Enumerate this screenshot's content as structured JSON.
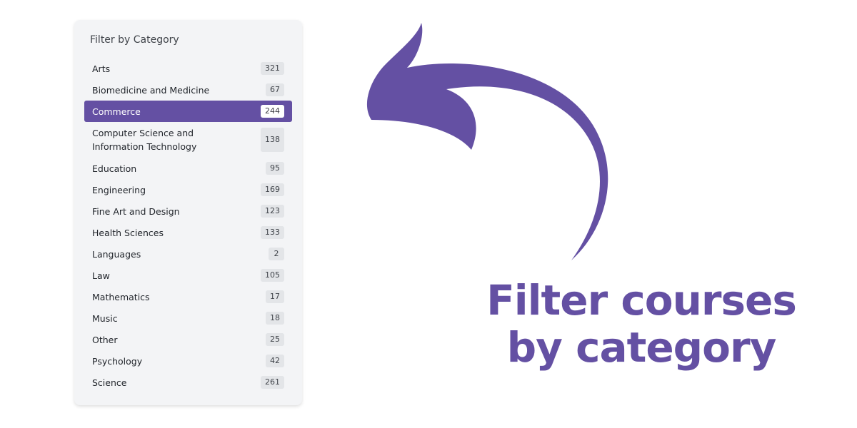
{
  "filter_panel": {
    "title": "Filter by Category",
    "categories": [
      {
        "label": "Arts",
        "count": "321"
      },
      {
        "label": "Biomedicine and Medicine",
        "count": "67"
      },
      {
        "label": "Commerce",
        "count": "244",
        "active": true
      },
      {
        "label": "Computer Science and Information Technology",
        "count": "138"
      },
      {
        "label": "Education",
        "count": "95"
      },
      {
        "label": "Engineering",
        "count": "169"
      },
      {
        "label": "Fine Art and Design",
        "count": "123"
      },
      {
        "label": "Health Sciences",
        "count": "133"
      },
      {
        "label": "Languages",
        "count": "2"
      },
      {
        "label": "Law",
        "count": "105"
      },
      {
        "label": "Mathematics",
        "count": "17"
      },
      {
        "label": "Music",
        "count": "18"
      },
      {
        "label": "Other",
        "count": "25"
      },
      {
        "label": "Psychology",
        "count": "42"
      },
      {
        "label": "Science",
        "count": "261"
      }
    ]
  },
  "headline": {
    "line1": "Filter courses",
    "line2": "by category"
  },
  "colors": {
    "accent": "#6450a3",
    "panel_bg": "#f3f4f6"
  },
  "icons": {
    "arrow": "curved-arrow-icon"
  }
}
